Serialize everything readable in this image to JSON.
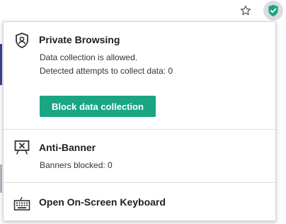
{
  "toolbar": {
    "star_icon": "star-outline-icon",
    "extension_icon": "kaspersky-shield-check-icon",
    "accent_color": "#1aa583"
  },
  "private_browsing": {
    "icon": "shield-user-icon",
    "title": "Private Browsing",
    "status": "Data collection is allowed.",
    "attempts": "Detected attempts to collect data: 0",
    "button_label": "Block data collection"
  },
  "anti_banner": {
    "icon": "banner-blocked-icon",
    "title": "Anti-Banner",
    "blocked": "Banners blocked: 0"
  },
  "keyboard": {
    "icon": "keyboard-icon",
    "title": "Open On-Screen Keyboard"
  }
}
